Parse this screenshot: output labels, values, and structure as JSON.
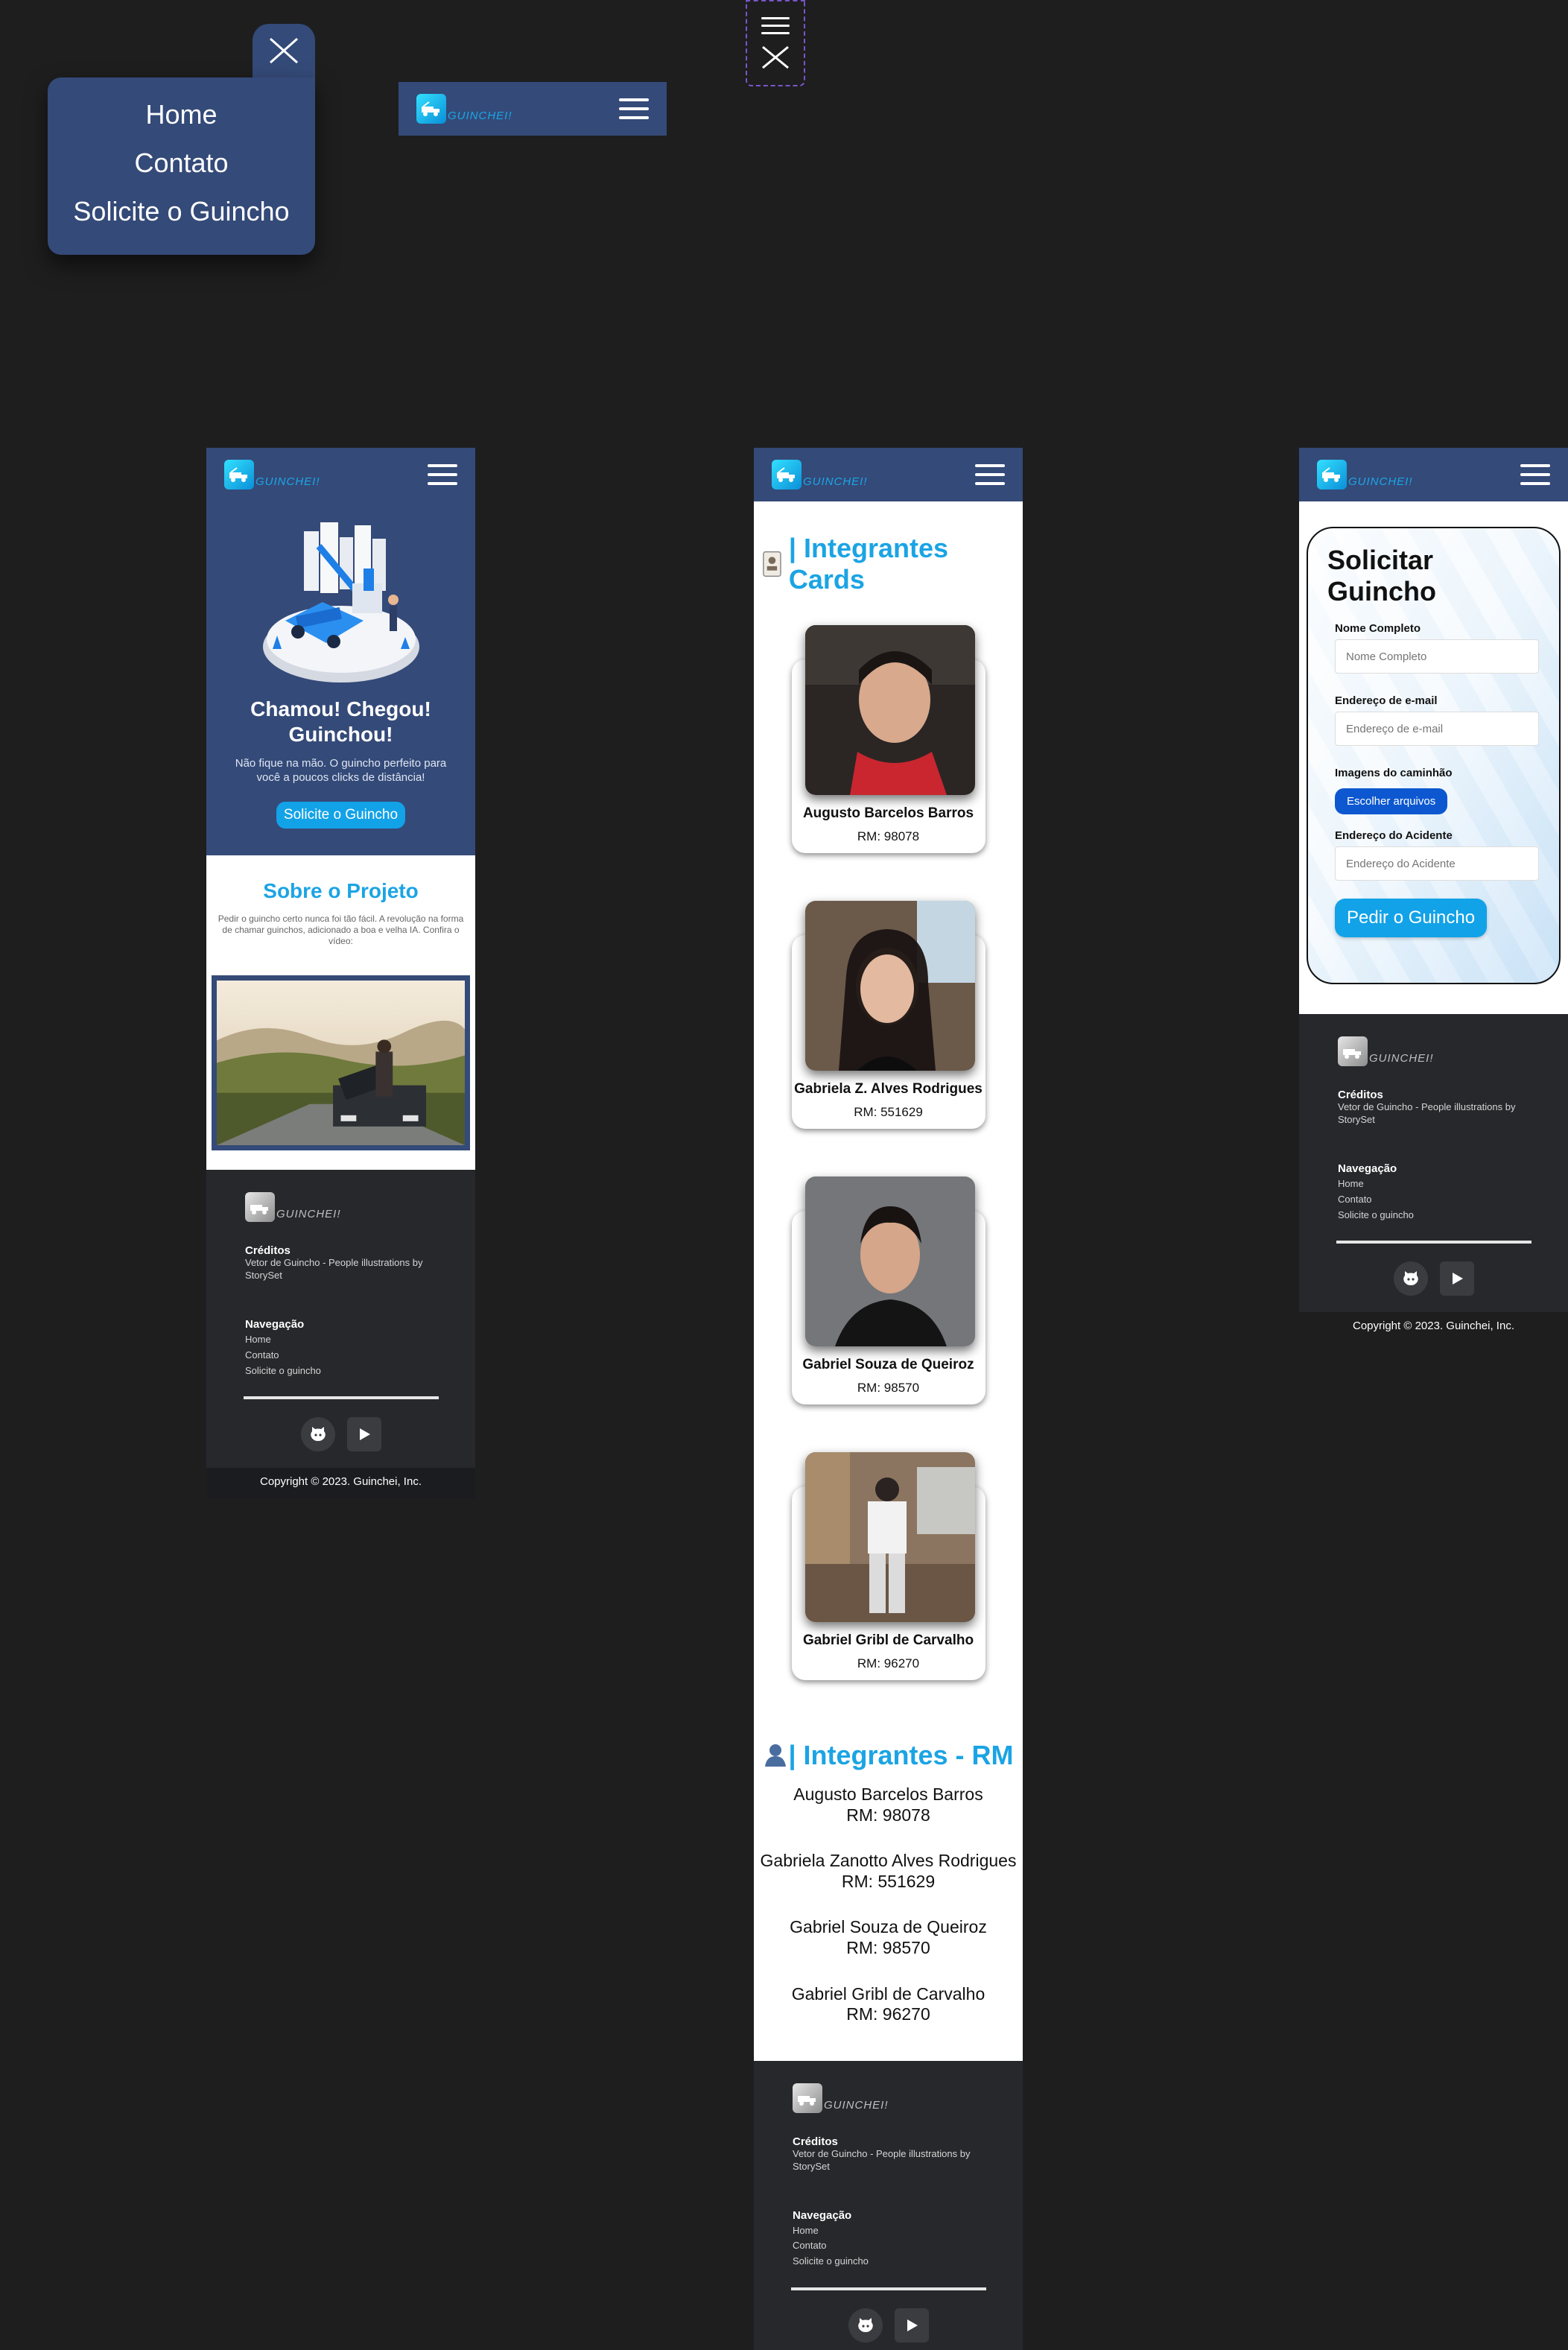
{
  "brand": {
    "name": "GUINCHEI!"
  },
  "menu": {
    "items": [
      {
        "label": "Home"
      },
      {
        "label": "Contato"
      },
      {
        "label": "Solicite o Guincho"
      }
    ]
  },
  "home": {
    "hero_title": "Chamou!  Chegou! Guinchou!",
    "hero_subtitle": "Não fique na mão. O guincho perfeito para você a poucos clicks de distância!",
    "hero_button": "Solicite o Guincho",
    "about_title": "Sobre o Projeto",
    "about_text": "Pedir o guincho certo nunca foi tão fácil. A revolução na forma de chamar guinchos, adicionado a boa e velha IA. Confira o vídeo:"
  },
  "team": {
    "cards_title": "| Integrantes Cards",
    "members": [
      {
        "name": "Augusto Barcelos Barros",
        "rm": "RM: 98078"
      },
      {
        "name": "Gabriela Z. Alves Rodrigues",
        "rm": "RM: 551629"
      },
      {
        "name": "Gabriel Souza de Queiroz",
        "rm": "RM: 98570"
      },
      {
        "name": "Gabriel Gribl de Carvalho",
        "rm": "RM: 96270"
      }
    ],
    "rm_title": "| Integrantes - RM",
    "rm_list": [
      {
        "name": "Augusto Barcelos Barros",
        "rm": "RM: 98078"
      },
      {
        "name": "Gabriela Zanotto Alves Rodrigues",
        "rm": "RM: 551629"
      },
      {
        "name": "Gabriel Souza de Queiroz",
        "rm": "RM: 98570"
      },
      {
        "name": "Gabriel Gribl de Carvalho",
        "rm": "RM: 96270"
      }
    ]
  },
  "form": {
    "title": "Solicitar Guincho",
    "name_label": "Nome Completo",
    "name_placeholder": "Nome Completo",
    "email_label": "Endereço de e-mail",
    "email_placeholder": "Endereço de e-mail",
    "images_label": "Imagens do caminhão",
    "file_button": "Escolher arquivos",
    "address_label": "Endereço do Acidente",
    "address_placeholder": "Endereço do Acidente",
    "submit": "Pedir o Guincho"
  },
  "footer": {
    "credits_heading": "Créditos",
    "credits_text": "Vetor de Guincho - People illustrations by StorySet",
    "nav_heading": "Navegação",
    "nav_links": [
      "Home",
      "Contato",
      "Solicite o guincho"
    ],
    "social": [
      "github-icon",
      "play-icon"
    ],
    "copyright": "Copyright © 2023. Guinchei, Inc."
  },
  "colors": {
    "header": "#344a78",
    "accent": "#1ba4e4",
    "footer": "#27282c",
    "background": "#1e1e1f"
  }
}
